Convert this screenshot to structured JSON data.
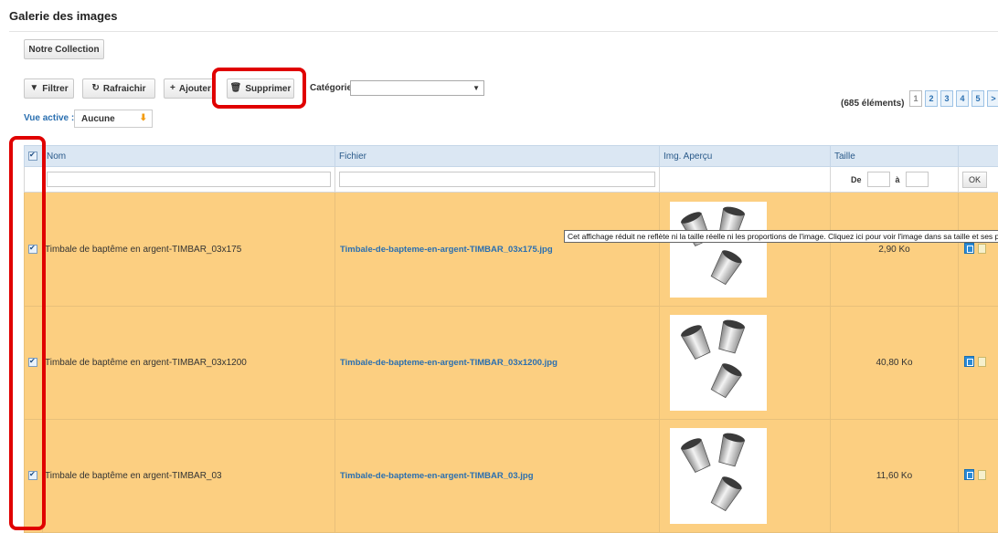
{
  "page": {
    "title": "Galerie des images"
  },
  "toolbar": {
    "collection_label": "Notre Collection",
    "filter_label": "Filtrer",
    "refresh_label": "Rafraichir",
    "add_label": "Ajouter",
    "delete_label": "Supprimer",
    "category_label": "Catégorie :",
    "category_value": ""
  },
  "view": {
    "label": "Vue active :",
    "value": "Aucune"
  },
  "pagination": {
    "count_text": "(685 éléments)",
    "pages": [
      "1",
      "2",
      "3",
      "4",
      "5"
    ],
    "next": ">"
  },
  "table": {
    "headers": {
      "name": "Nom",
      "file": "Fichier",
      "preview": "Img. Aperçu",
      "size": "Taille"
    },
    "filters": {
      "size_from": "De",
      "size_to": "à",
      "ok": "OK"
    },
    "rows": [
      {
        "name": "Timbale de baptême en argent-TIMBAR_03x175",
        "file": "Timbale-de-bapteme-en-argent-TIMBAR_03x175.jpg",
        "size": "2,90 Ko"
      },
      {
        "name": "Timbale de baptême en argent-TIMBAR_03x1200",
        "file": "Timbale-de-bapteme-en-argent-TIMBAR_03x1200.jpg",
        "size": "40,80 Ko"
      },
      {
        "name": "Timbale de baptême en argent-TIMBAR_03",
        "file": "Timbale-de-bapteme-en-argent-TIMBAR_03.jpg",
        "size": "11,60 Ko"
      }
    ]
  },
  "tooltip": {
    "text": "Cet affichage réduit ne reflète ni la taille réelle ni les proportions de l'image. Cliquez ici pour voir l'image dans sa taille et ses proportions réelles."
  },
  "colors": {
    "row_selected": "#fccf81",
    "header_bg": "#dbe7f3",
    "highlight": "#e00000",
    "link": "#2a6fb0"
  }
}
